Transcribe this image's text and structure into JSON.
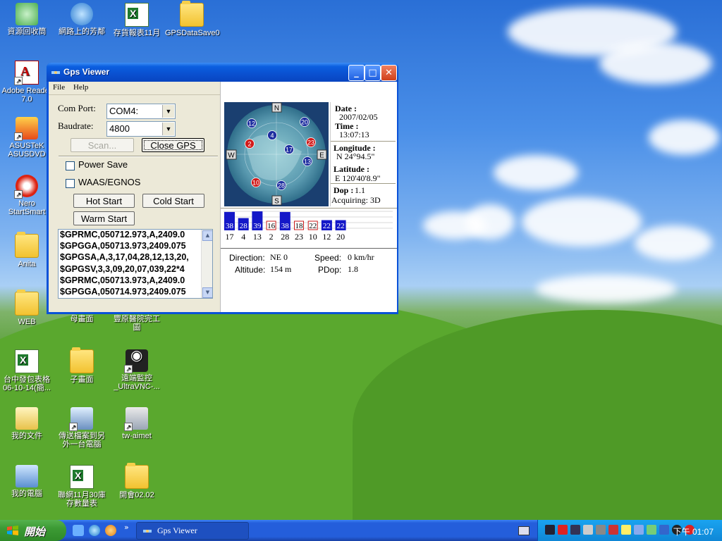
{
  "desktop": {
    "icons": [
      {
        "label": "資源回收筒"
      },
      {
        "label": "網路上的芳鄰"
      },
      {
        "label": "存貨報表11月"
      },
      {
        "label": "GPSDataSave0"
      },
      {
        "label": "Adobe Reader 7.0"
      },
      {
        "label": "ASUSTeK ASUSDVD"
      },
      {
        "label": "Nero StartSmart"
      },
      {
        "label": "Anita"
      },
      {
        "label": "WEB"
      },
      {
        "label": "母畫面"
      },
      {
        "label": "豐原醫院完工圖"
      },
      {
        "label": "台中發包表格 06-10-14(簡..."
      },
      {
        "label": "子畫面"
      },
      {
        "label": "遠端監控 _UltraVNC-..."
      },
      {
        "label": "我的文件"
      },
      {
        "label": "傳送檔案到另外一台電腦"
      },
      {
        "label": "tw-aimet"
      },
      {
        "label": "我的電腦"
      },
      {
        "label": "聯網11月30庫存數量表"
      },
      {
        "label": "開會02.02"
      }
    ]
  },
  "window": {
    "title": "Gps Viewer",
    "menu": {
      "file": "File",
      "help": "Help"
    },
    "com_port_label": "Com Port:",
    "com_port_value": "COM4:",
    "baudrate_label": "Baudrate:",
    "baudrate_value": "4800",
    "scan_button": "Scan...",
    "close_gps_button": "Close GPS",
    "power_save_label": "Power Save",
    "waas_label": "WAAS/EGNOS",
    "hot_start_button": "Hot Start",
    "cold_start_button": "Cold Start",
    "warm_start_button": "Warm Start",
    "nmea_lines": [
      "$GPRMC,050712.973,A,2409.0",
      "$GPGGA,050713.973,2409.075",
      "$GPGSA,A,3,17,04,28,12,13,20,",
      "$GPGSV,3,3,09,20,07,039,22*4",
      "$GPRMC,050713.973,A,2409.0",
      "$GPGGA,050714.973,2409.075"
    ],
    "info": {
      "date_label": "Date :",
      "date_value": "2007/02/05",
      "time_label": "Time :",
      "time_value": "13:07:13",
      "longitude_label": "Longitude :",
      "longitude_value": "N  24°94.5\"",
      "latitude_label": "Latitude :",
      "latitude_value": "E 120'40'8.9\"",
      "dop_label": "Dop :",
      "dop_value": "1.1",
      "acquiring_text": "Acquiring: 3D"
    },
    "sky": {
      "compass": {
        "n": "N",
        "s": "S",
        "e": "E",
        "w": "W"
      },
      "satellites": [
        {
          "id": "12",
          "color": "#1e2ea0"
        },
        {
          "id": "20",
          "color": "#1e2ea0"
        },
        {
          "id": "4",
          "color": "#1e2ea0"
        },
        {
          "id": "2",
          "color": "#d21a1a"
        },
        {
          "id": "23",
          "color": "#d21a1a"
        },
        {
          "id": "17",
          "color": "#1e2ea0"
        },
        {
          "id": "13",
          "color": "#1e2ea0"
        },
        {
          "id": "10",
          "color": "#d21a1a"
        },
        {
          "id": "28",
          "color": "#1e2ea0"
        }
      ]
    },
    "signal_bars": [
      {
        "snr": "38",
        "prn": "17",
        "used": true,
        "level": 0.9
      },
      {
        "snr": "28",
        "prn": "4",
        "used": true,
        "level": 0.6
      },
      {
        "snr": "39",
        "prn": "13",
        "used": true,
        "level": 0.93
      },
      {
        "snr": "16",
        "prn": "2",
        "used": false,
        "level": 0.35
      },
      {
        "snr": "38",
        "prn": "28",
        "used": true,
        "level": 0.9
      },
      {
        "snr": "18",
        "prn": "23",
        "used": false,
        "level": 0.4
      },
      {
        "snr": "22",
        "prn": "10",
        "used": false,
        "level": 0.5
      },
      {
        "snr": "22",
        "prn": "12",
        "used": true,
        "level": 0.5
      },
      {
        "snr": "22",
        "prn": "20",
        "used": true,
        "level": 0.5
      }
    ],
    "direction_label": "Direction:",
    "direction_value": "NE 0",
    "speed_label": "Speed:",
    "speed_value": "0 km/hr",
    "altitude_label": "Altitude:",
    "altitude_value": "154 m",
    "pdop_label": "PDop:",
    "pdop_value": "1.8"
  },
  "taskbar": {
    "start_label": "開始",
    "task_gps": "Gps Viewer",
    "clock": "下午 01:07",
    "colors": {
      "taskbar": "#245edb",
      "start": "#3c9a34",
      "tray": "#0f87d6"
    }
  }
}
